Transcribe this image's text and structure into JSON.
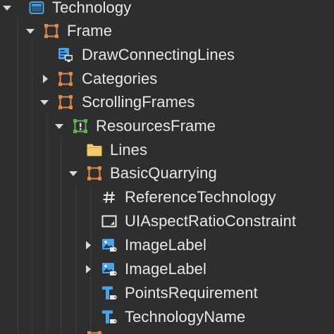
{
  "explorer": {
    "items": [
      {
        "label": "Technology",
        "icon": "screen-gui-icon",
        "expanded": true
      },
      {
        "label": "Frame",
        "icon": "frame-icon",
        "expanded": true
      },
      {
        "label": "DrawConnectingLines",
        "icon": "local-script-icon"
      },
      {
        "label": "Categories",
        "icon": "frame-icon",
        "expanded": false
      },
      {
        "label": "ScrollingFrames",
        "icon": "frame-icon",
        "expanded": true
      },
      {
        "label": "ResourcesFrame",
        "icon": "scrolling-frame-icon",
        "expanded": true
      },
      {
        "label": "Lines",
        "icon": "folder-icon"
      },
      {
        "label": "BasicQuarrying",
        "icon": "frame-icon",
        "expanded": true
      },
      {
        "label": "ReferenceTechnology",
        "icon": "value-icon"
      },
      {
        "label": "UIAspectRatioConstraint",
        "icon": "aspect-ratio-constraint-icon"
      },
      {
        "label": "ImageLabel",
        "icon": "image-label-icon",
        "expanded": false
      },
      {
        "label": "ImageLabel",
        "icon": "image-label-icon",
        "expanded": false
      },
      {
        "label": "PointsRequirement",
        "icon": "text-label-icon"
      },
      {
        "label": "TechnologyName",
        "icon": "text-label-icon"
      }
    ]
  },
  "colors": {
    "background": "#2e2e2e",
    "frame_orange": "#e08a4a",
    "folder_yellow": "#f2cc6b",
    "scrolling_green": "#63b25a",
    "icon_blue": "#4aa3e8",
    "text": "#e8e8e8"
  }
}
